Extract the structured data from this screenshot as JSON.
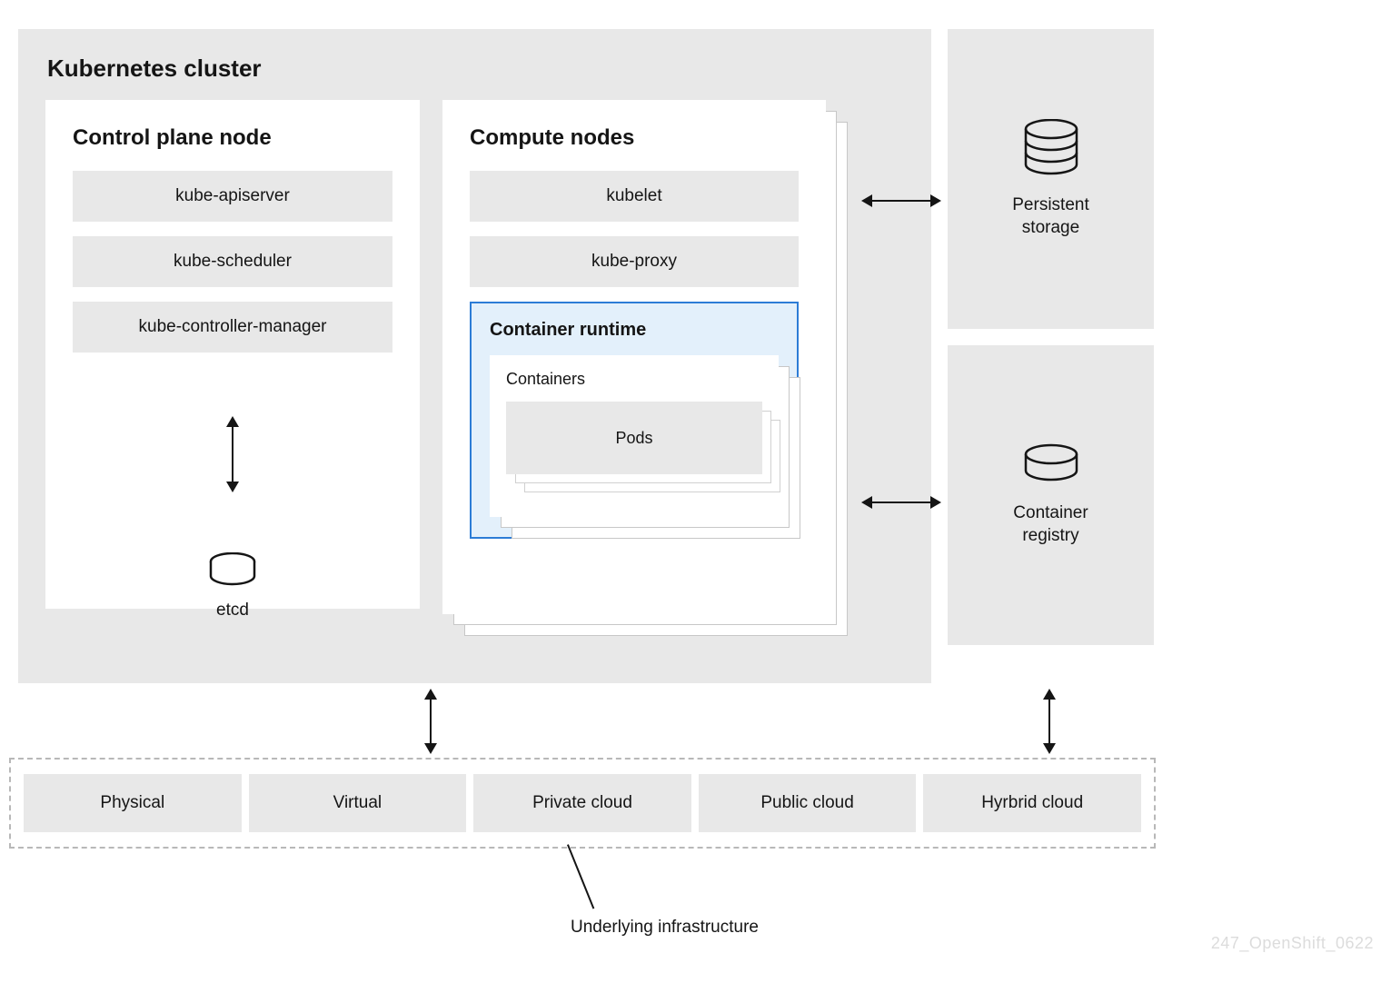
{
  "cluster": {
    "title": "Kubernetes cluster",
    "control_plane": {
      "title": "Control plane node",
      "items": [
        "kube-apiserver",
        "kube-scheduler",
        "kube-controller-manager"
      ],
      "etcd_label": "etcd"
    },
    "compute_nodes": {
      "title": "Compute nodes",
      "items": [
        "kubelet",
        "kube-proxy"
      ],
      "container_runtime": {
        "title": "Container runtime",
        "containers_label": "Containers",
        "pods_label": "Pods"
      }
    }
  },
  "right": {
    "storage_label": "Persistent\nstorage",
    "registry_label": "Container\nregistry"
  },
  "infrastructure": {
    "items": [
      "Physical",
      "Virtual",
      "Private cloud",
      "Public cloud",
      "Hyrbrid cloud"
    ],
    "caption": "Underlying infrastructure"
  },
  "watermark": "247_OpenShift_0622"
}
